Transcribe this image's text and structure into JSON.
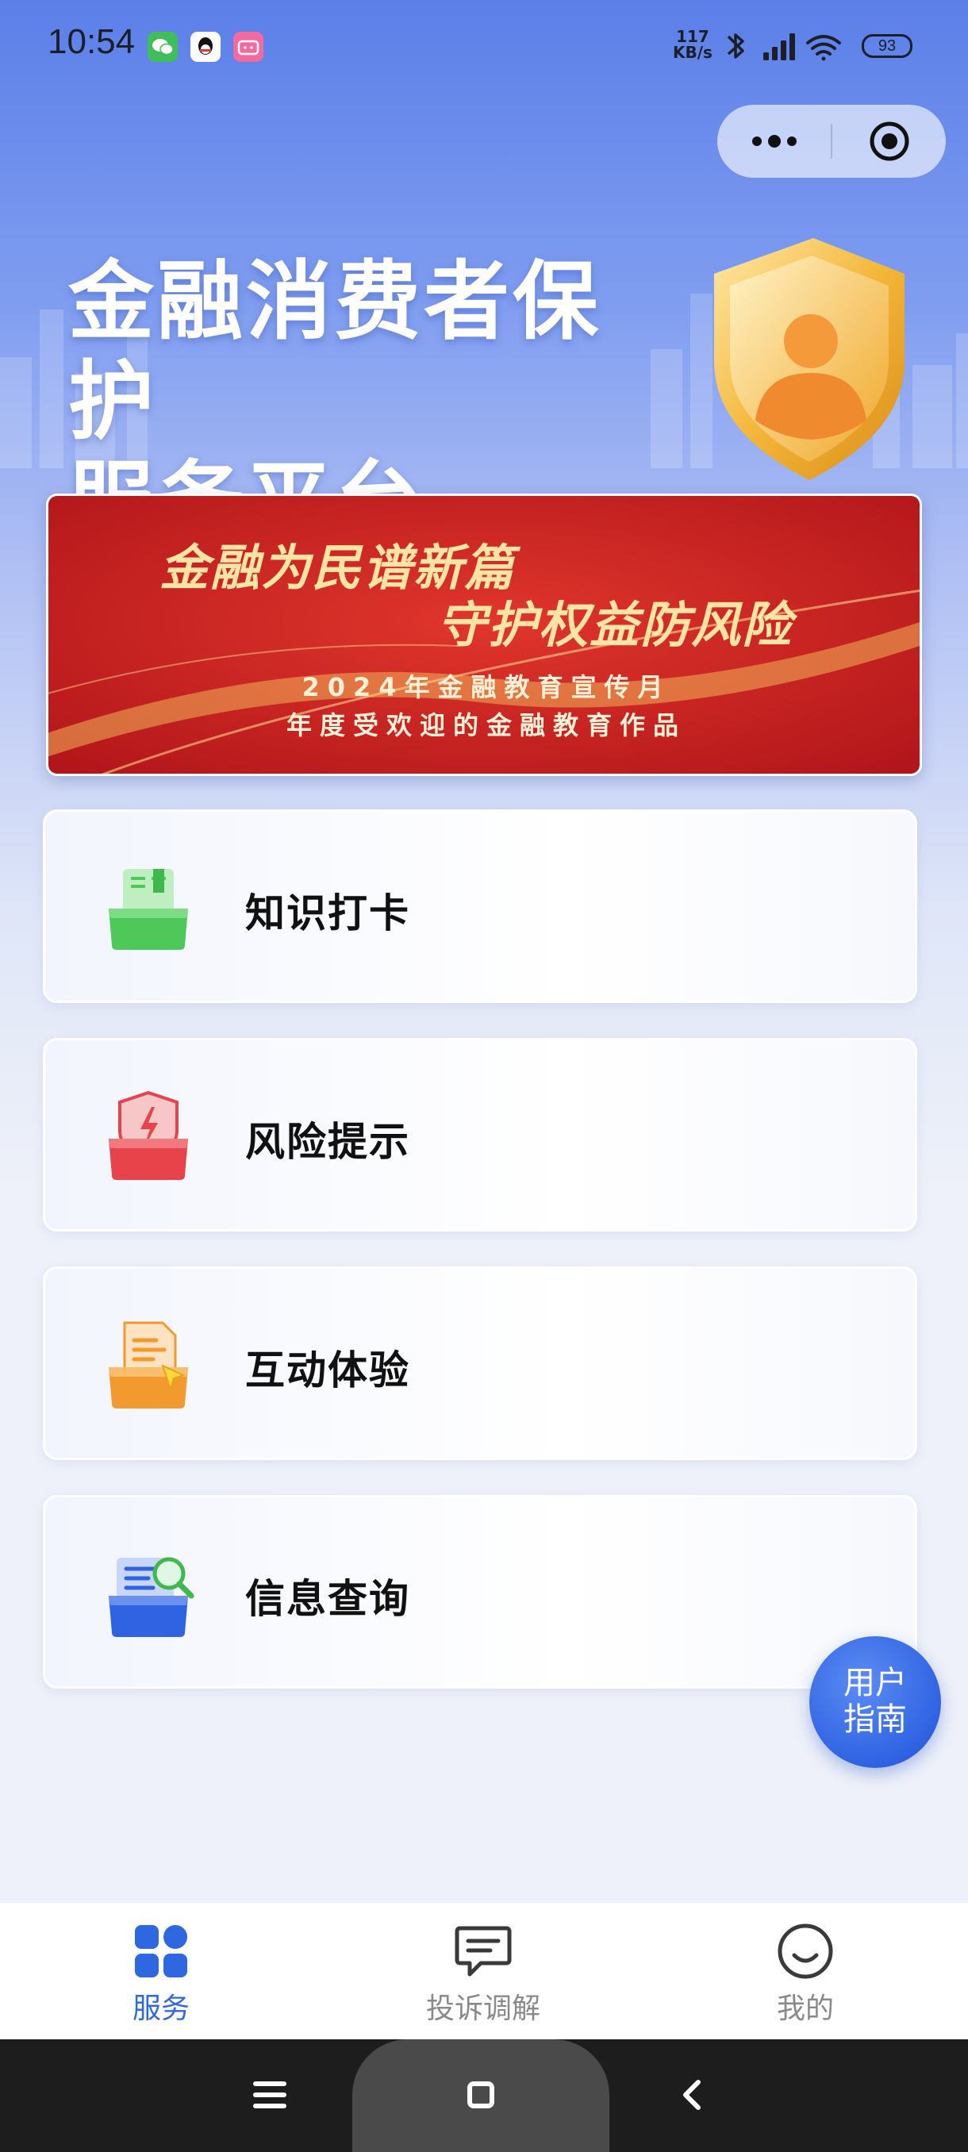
{
  "status_bar": {
    "time": "10:54",
    "net_speed_value": "117",
    "net_speed_unit": "KB/s",
    "battery": "93",
    "icons": [
      "wechat-icon",
      "qq-icon",
      "bilibili-icon",
      "bluetooth-icon",
      "signal-icon",
      "wifi-icon",
      "battery-icon"
    ]
  },
  "capsule": {
    "more_icon": "more-dots-icon",
    "close_icon": "target-close-icon"
  },
  "hero": {
    "title_line1": "金融消费者保护",
    "title_line2": "服务平台",
    "emblem": "shield-user-icon"
  },
  "banner": {
    "line1": "金融为民谱新篇",
    "line2": "守护权益防风险",
    "line3": "2024年金融教育宣传月",
    "line4": "年度受欢迎的金融教育作品"
  },
  "menu": {
    "items": [
      {
        "label": "知识打卡",
        "icon": "book-tray-icon",
        "color": "#4fc85a"
      },
      {
        "label": "风险提示",
        "icon": "warning-shield-icon",
        "color": "#e8434a"
      },
      {
        "label": "互动体验",
        "icon": "document-cursor-icon",
        "color": "#f29a2e"
      },
      {
        "label": "信息查询",
        "icon": "search-folder-icon",
        "color": "#2f63e2"
      }
    ]
  },
  "guide_button": {
    "line1": "用户",
    "line2": "指南"
  },
  "tab_bar": {
    "tabs": [
      {
        "label": "服务",
        "icon": "grid-apps-icon",
        "active": true
      },
      {
        "label": "投诉调解",
        "icon": "chat-bubble-icon",
        "active": false
      },
      {
        "label": "我的",
        "icon": "smile-face-icon",
        "active": false
      }
    ],
    "active_color": "#2f67e0",
    "inactive_color": "#8a8a8a"
  },
  "nav_bar": {
    "icons": [
      "menu-icon",
      "home-square-icon",
      "back-chevron-icon"
    ]
  }
}
